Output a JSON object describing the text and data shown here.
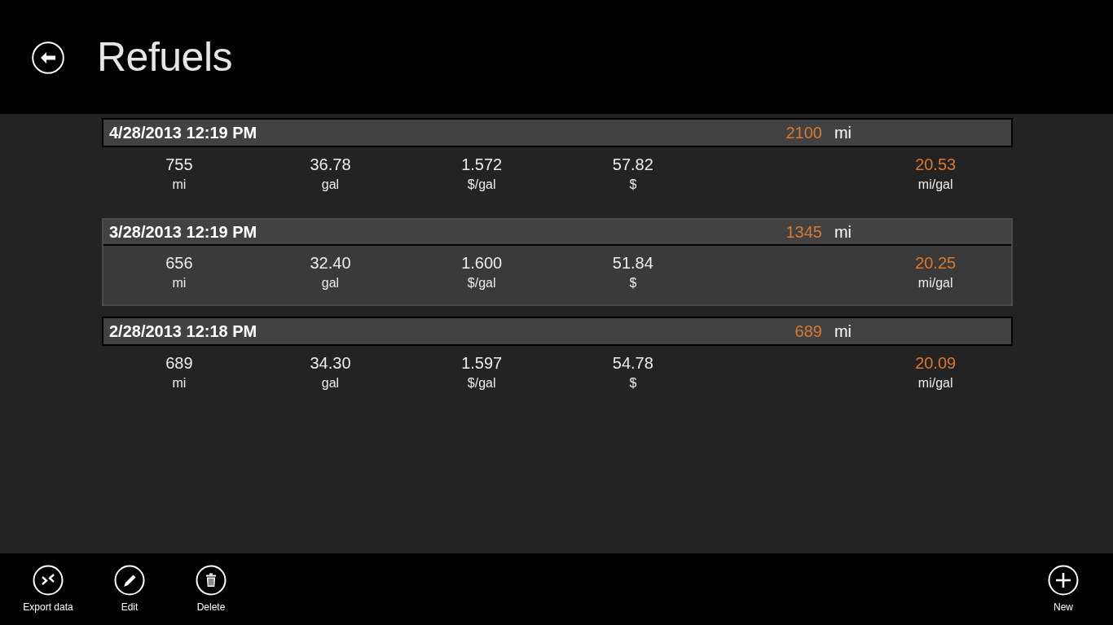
{
  "header": {
    "title": "Refuels"
  },
  "refuels": [
    {
      "date": "4/28/2013 12:19 PM",
      "odometer": "2100",
      "odometer_unit": "mi",
      "selected": false,
      "stats": [
        {
          "value": "755",
          "unit": "mi"
        },
        {
          "value": "36.78",
          "unit": "gal"
        },
        {
          "value": "1.572",
          "unit": "$/gal"
        },
        {
          "value": "57.82",
          "unit": "$"
        }
      ],
      "efficiency": {
        "value": "20.53",
        "unit": "mi/gal"
      }
    },
    {
      "date": "3/28/2013 12:19 PM",
      "odometer": "1345",
      "odometer_unit": "mi",
      "selected": true,
      "stats": [
        {
          "value": "656",
          "unit": "mi"
        },
        {
          "value": "32.40",
          "unit": "gal"
        },
        {
          "value": "1.600",
          "unit": "$/gal"
        },
        {
          "value": "51.84",
          "unit": "$"
        }
      ],
      "efficiency": {
        "value": "20.25",
        "unit": "mi/gal"
      }
    },
    {
      "date": "2/28/2013 12:18 PM",
      "odometer": "689",
      "odometer_unit": "mi",
      "selected": false,
      "stats": [
        {
          "value": "689",
          "unit": "mi"
        },
        {
          "value": "34.30",
          "unit": "gal"
        },
        {
          "value": "1.597",
          "unit": "$/gal"
        },
        {
          "value": "54.78",
          "unit": "$"
        }
      ],
      "efficiency": {
        "value": "20.09",
        "unit": "mi/gal"
      }
    }
  ],
  "app_bar": {
    "left": [
      {
        "kind": "export",
        "label": "Export data"
      },
      {
        "kind": "edit",
        "label": "Edit"
      },
      {
        "kind": "delete",
        "label": "Delete"
      }
    ],
    "right": [
      {
        "kind": "add",
        "label": "New"
      }
    ]
  }
}
